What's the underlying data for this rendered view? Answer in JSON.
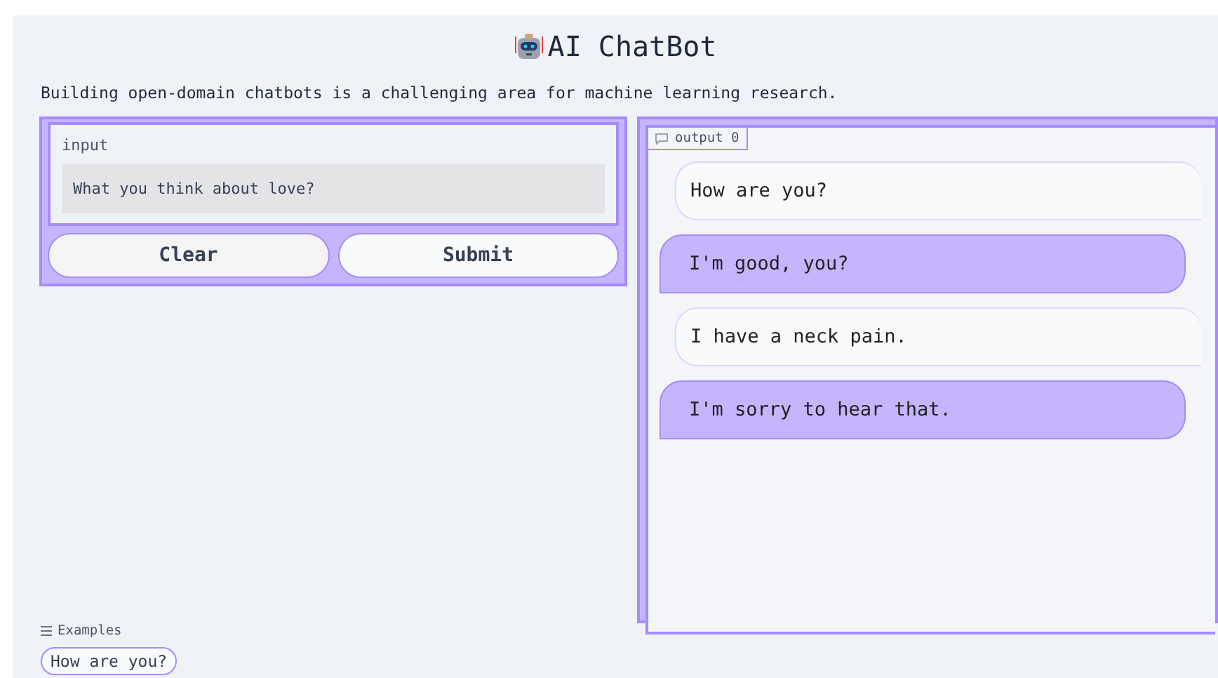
{
  "title": "AI ChatBot",
  "description": "Building open-domain chatbots is a challenging area for machine learning research.",
  "input": {
    "label": "input",
    "value": "What you think about love?"
  },
  "buttons": [
    {
      "label": "Clear",
      "kind": "secondary"
    },
    {
      "label": "Submit",
      "kind": "primary"
    }
  ],
  "output": {
    "label": "output 0",
    "messages": [
      {
        "kind": "user",
        "text": "How are you?"
      },
      {
        "kind": "bot",
        "text": "I'm good, you?"
      },
      {
        "kind": "user",
        "text": "I have a neck pain."
      },
      {
        "kind": "bot",
        "text": "I'm sorry to hear that."
      }
    ]
  },
  "examples": {
    "label": "Examples",
    "items": [
      "How are you?"
    ]
  }
}
